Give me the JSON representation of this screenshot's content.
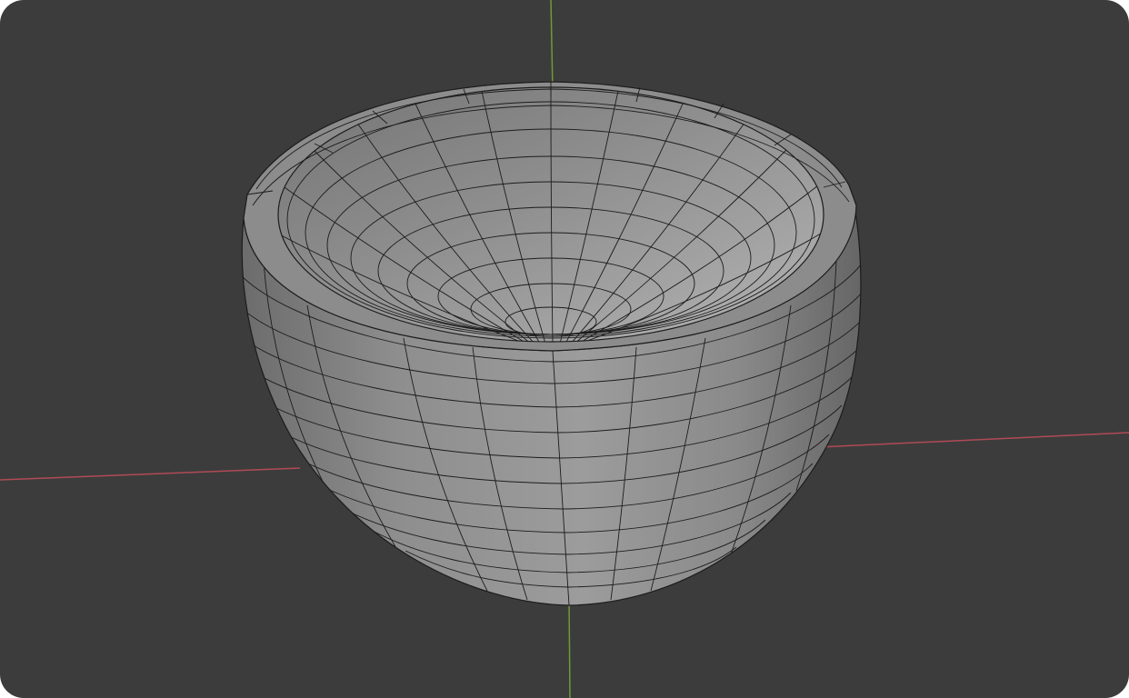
{
  "viewport": {
    "background_color": "#3c3c3c",
    "x_axis_color": "#b04a56",
    "y_axis_color": "#6f9a3a",
    "mesh_face_color": "#9a9a9a",
    "mesh_wire_color": "#1c1c1c"
  },
  "object": {
    "type": "mesh",
    "shape": "bowl"
  }
}
